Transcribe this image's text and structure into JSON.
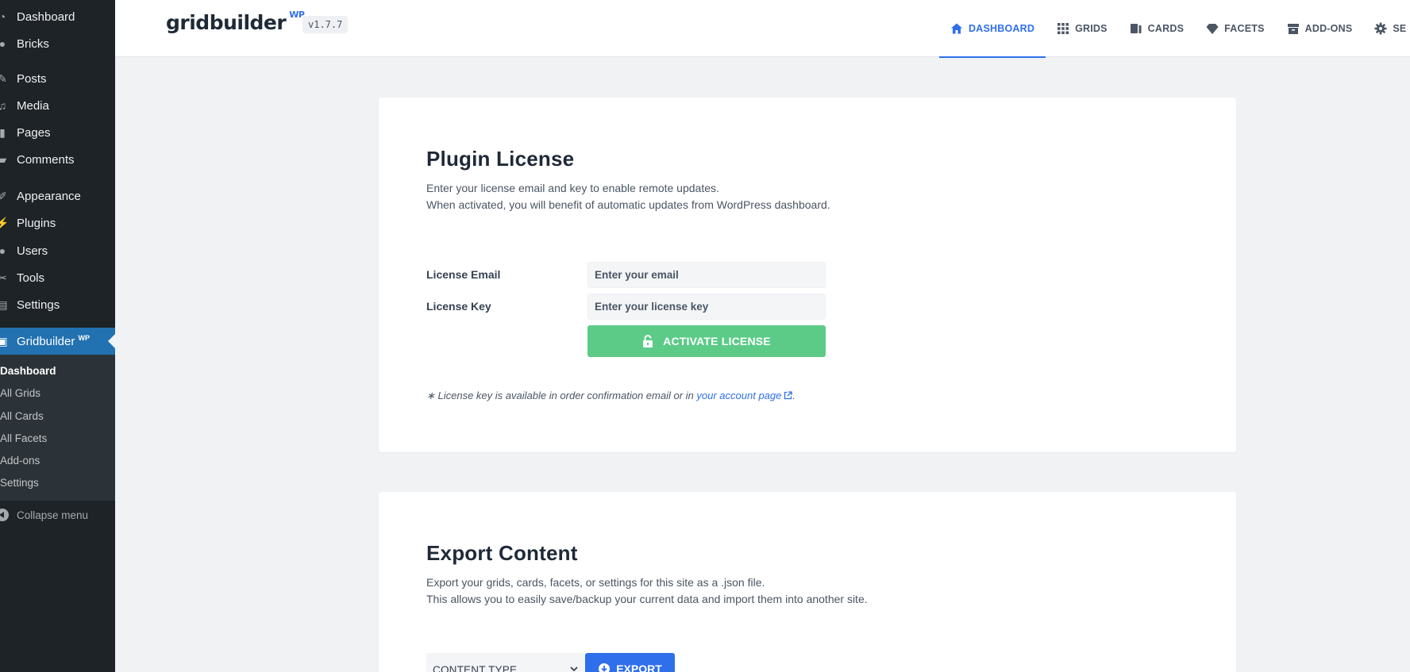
{
  "sidebar": {
    "items": [
      {
        "label": "Dashboard",
        "icon": "dashboard-icon"
      },
      {
        "label": "Bricks",
        "icon": "bricks-icon"
      },
      {
        "label": "Posts",
        "icon": "pin-icon"
      },
      {
        "label": "Media",
        "icon": "media-icon"
      },
      {
        "label": "Pages",
        "icon": "page-icon"
      },
      {
        "label": "Comments",
        "icon": "comment-icon"
      },
      {
        "label": "Appearance",
        "icon": "brush-icon"
      },
      {
        "label": "Plugins",
        "icon": "plug-icon"
      },
      {
        "label": "Users",
        "icon": "user-icon"
      },
      {
        "label": "Tools",
        "icon": "wrench-icon"
      },
      {
        "label": "Settings",
        "icon": "sliders-icon"
      }
    ],
    "active": {
      "label": "Gridbuilder",
      "sup": "WP"
    },
    "submenu": [
      "Dashboard",
      "All Grids",
      "All Cards",
      "All Facets",
      "Add-ons",
      "Settings"
    ],
    "collapse_label": "Collapse menu"
  },
  "header": {
    "logo": "gridbuilder",
    "logo_sup": "WP",
    "version": "v1.7.7",
    "nav": [
      {
        "label": "DASHBOARD",
        "icon": "home-icon"
      },
      {
        "label": "GRIDS",
        "icon": "grid-icon"
      },
      {
        "label": "CARDS",
        "icon": "cards-icon"
      },
      {
        "label": "FACETS",
        "icon": "diamond-icon"
      },
      {
        "label": "ADD-ONS",
        "icon": "box-icon"
      },
      {
        "label": "SE",
        "icon": "gear-icon"
      }
    ]
  },
  "license": {
    "title": "Plugin License",
    "desc_line1": "Enter your license email and key to enable remote updates.",
    "desc_line2": "When activated, you will benefit of automatic updates from WordPress dashboard.",
    "email_label": "License Email",
    "email_placeholder": "Enter your email",
    "key_label": "License Key",
    "key_placeholder": "Enter your license key",
    "activate_label": "ACTIVATE LICENSE",
    "note_prefix": "∗ License key is available in order confirmation email or in",
    "note_link": "your account page",
    "note_suffix": "."
  },
  "export": {
    "title": "Export Content",
    "desc_line1": "Export your grids, cards, facets, or settings for this site as a .json file.",
    "desc_line2": "This allows you to easily save/backup your current data and import them into another site.",
    "select_label": "CONTENT TYPE",
    "button_label": "EXPORT"
  },
  "colors": {
    "accent": "#2f6fec",
    "wp_sidebar": "#1d2327",
    "wp_active": "#2271b1",
    "activate_green": "#5ccb88"
  }
}
